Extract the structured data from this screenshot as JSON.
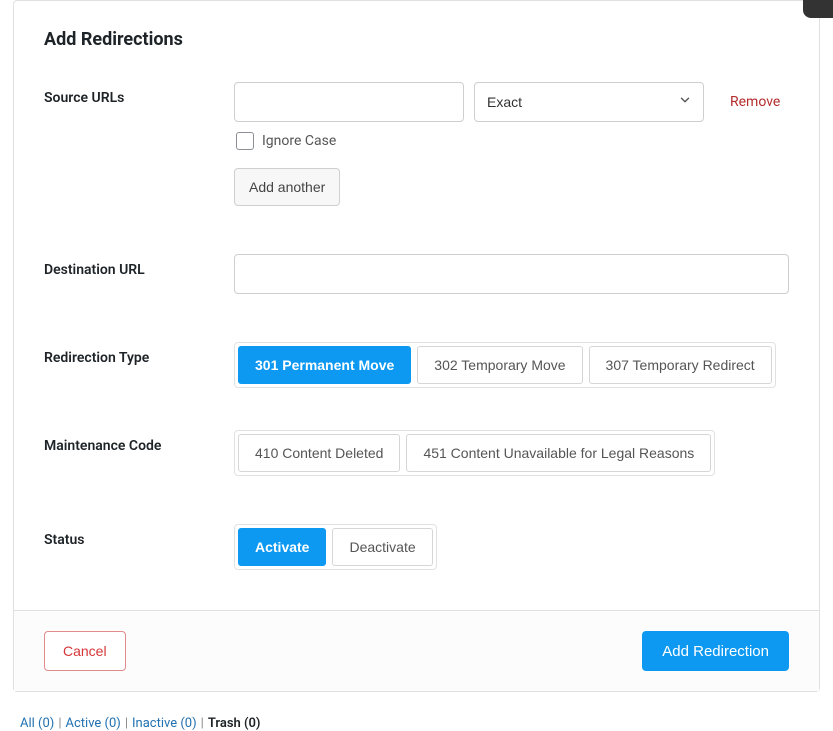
{
  "title": "Add Redirections",
  "labels": {
    "source_urls": "Source URLs",
    "destination_url": "Destination URL",
    "redirection_type": "Redirection Type",
    "maintenance_code": "Maintenance Code",
    "status": "Status"
  },
  "source": {
    "value": "",
    "match_mode": "Exact",
    "remove_label": "Remove",
    "ignore_case_label": "Ignore Case",
    "ignore_case_checked": false,
    "add_another_label": "Add another"
  },
  "destination": {
    "value": ""
  },
  "redirection_types": [
    {
      "label": "301 Permanent Move",
      "active": true
    },
    {
      "label": "302 Temporary Move",
      "active": false
    },
    {
      "label": "307 Temporary Redirect",
      "active": false
    }
  ],
  "maintenance_codes": [
    {
      "label": "410 Content Deleted",
      "active": false
    },
    {
      "label": "451 Content Unavailable for Legal Reasons",
      "active": false
    }
  ],
  "status_options": [
    {
      "label": "Activate",
      "active": true
    },
    {
      "label": "Deactivate",
      "active": false
    }
  ],
  "footer": {
    "cancel": "Cancel",
    "submit": "Add Redirection"
  },
  "tabs_strip": {
    "items": [
      {
        "label": "All (0)",
        "active": false
      },
      {
        "label": "Active (0)",
        "active": false
      },
      {
        "label": "Inactive (0)",
        "active": false
      },
      {
        "label": "Trash (0)",
        "active": true
      }
    ]
  }
}
